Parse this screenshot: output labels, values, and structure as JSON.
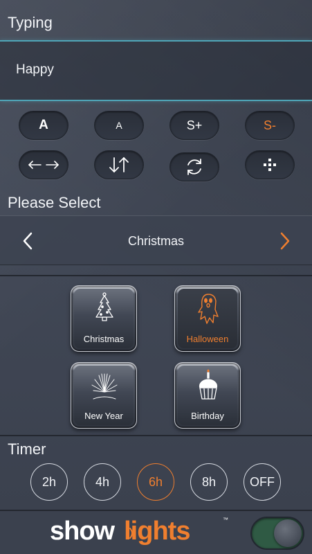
{
  "typing": {
    "title": "Typing",
    "text": "Happy"
  },
  "text_controls": {
    "font_larger": "A",
    "font_smaller": "A",
    "speed_up": "S+",
    "speed_down": "S-"
  },
  "motion_controls": {
    "horizontal_icon": "left-right-arrows-icon",
    "vertical_icon": "down-up-arrows-icon",
    "rotate_icon": "rotate-icon",
    "scatter_icon": "scatter-dots-icon"
  },
  "select": {
    "title": "Please Select",
    "value": "Christmas"
  },
  "themes": [
    {
      "label": "Christmas",
      "icon": "christmas-tree-icon",
      "active": false
    },
    {
      "label": "Halloween",
      "icon": "ghost-icon",
      "active": true
    },
    {
      "label": "New Year",
      "icon": "fireworks-icon",
      "active": false
    },
    {
      "label": "Birthday",
      "icon": "cupcake-icon",
      "active": false
    }
  ],
  "timer": {
    "title": "Timer",
    "options": [
      "2h",
      "4h",
      "6h",
      "8h",
      "OFF"
    ],
    "selected": "6h"
  },
  "footer": {
    "logo_show": "show",
    "logo_lights": "lights",
    "logo_tm": "™",
    "power_on": true
  },
  "colors": {
    "accent": "#f07f2f",
    "highlight_line": "#4fa6b8",
    "background": "#3d4452"
  }
}
